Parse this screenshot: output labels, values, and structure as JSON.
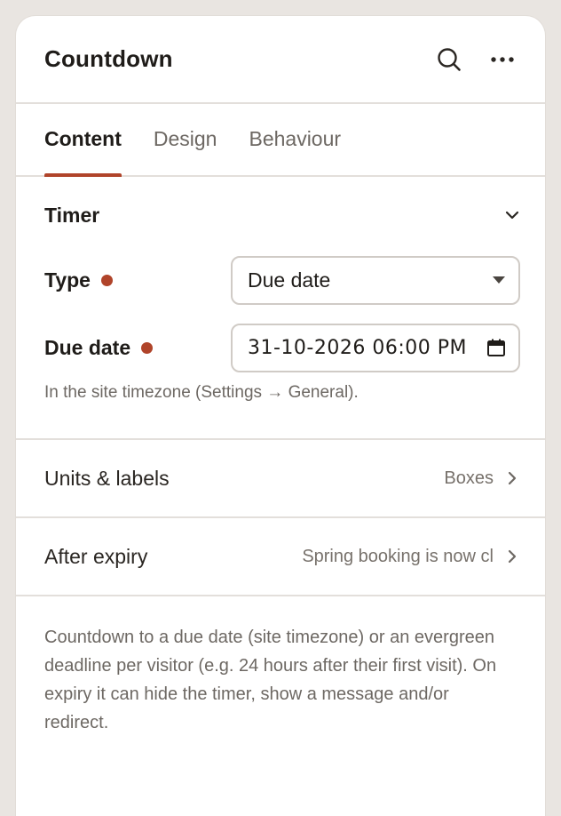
{
  "panel": {
    "title": "Countdown",
    "actions": {
      "search_icon": "search-icon",
      "more_icon": "more-horizontal-icon"
    }
  },
  "tabs": [
    {
      "label": "Content",
      "active": true
    },
    {
      "label": "Design",
      "active": false
    },
    {
      "label": "Behaviour",
      "active": false
    }
  ],
  "timer": {
    "title": "Timer",
    "type": {
      "label": "Type",
      "value": "Due date"
    },
    "due_date": {
      "label": "Due date",
      "value": "31-10-2026 06:00 PM"
    },
    "hint": "In the site timezone (Settings → General)."
  },
  "units_labels": {
    "label": "Units & labels",
    "value": "Boxes"
  },
  "after_expiry": {
    "label": "After expiry",
    "value": "Spring booking is now cl"
  },
  "description": "Countdown to a due date (site timezone) or an evergreen deadline per visitor (e.g. 24 hours after their first visit). On expiry it can hide the timer, show a message and/or redirect.",
  "colors": {
    "accent": "#b0442a",
    "border": "#e3dfdb",
    "muted": "#6d6863"
  }
}
